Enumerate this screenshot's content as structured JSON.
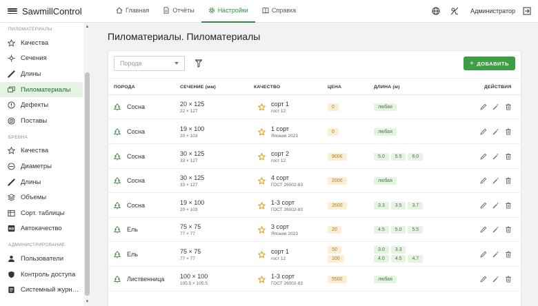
{
  "app": {
    "title": "SawmillControl"
  },
  "nav": [
    {
      "label": "Главная",
      "icon": "home-icon",
      "active": false
    },
    {
      "label": "Отчёты",
      "icon": "document-icon",
      "active": false
    },
    {
      "label": "Настройки",
      "icon": "gear-icon",
      "active": true
    },
    {
      "label": "Справка",
      "icon": "help-icon",
      "active": false
    }
  ],
  "topbar": {
    "user": "Администратор"
  },
  "sidebar": {
    "groups": [
      {
        "title": "ПИЛОМАТЕРИАЛЫ",
        "items": [
          {
            "label": "Качества",
            "icon": "star-icon",
            "active": false
          },
          {
            "label": "Сечения",
            "icon": "crosshair-icon",
            "active": false
          },
          {
            "label": "Длины",
            "icon": "ruler-icon",
            "active": false
          },
          {
            "label": "Пиломатериалы",
            "icon": "lumber-icon",
            "active": true
          },
          {
            "label": "Дефекты",
            "icon": "warning-icon",
            "active": false
          },
          {
            "label": "Поставы",
            "icon": "target-icon",
            "active": false
          }
        ]
      },
      {
        "title": "БРЕВНА",
        "items": [
          {
            "label": "Качества",
            "icon": "star-icon",
            "active": false
          },
          {
            "label": "Диаметры",
            "icon": "diameter-icon",
            "active": false
          },
          {
            "label": "Длины",
            "icon": "ruler-icon",
            "active": false
          },
          {
            "label": "Объемы",
            "icon": "layers-icon",
            "active": false
          },
          {
            "label": "Сорт. таблицы",
            "icon": "table-icon",
            "active": false
          },
          {
            "label": "Автокачество",
            "icon": "auto-icon",
            "active": false
          }
        ]
      },
      {
        "title": "АДМИНИСТРИРОВАНИЕ",
        "items": [
          {
            "label": "Пользователи",
            "icon": "users-icon",
            "active": false
          },
          {
            "label": "Контроль доступа",
            "icon": "shield-icon",
            "active": false
          },
          {
            "label": "Системный журн…",
            "icon": "log-icon",
            "active": false
          }
        ]
      }
    ]
  },
  "page": {
    "title": "Пиломатериалы. Пиломатериалы"
  },
  "toolbar": {
    "select_placeholder": "Порода",
    "add_label": "ДОБАВИТЬ"
  },
  "table": {
    "headers": {
      "poroda": "ПОРОДА",
      "sechenie": "СЕЧЕНИЕ (мм)",
      "kachestvo": "КАЧЕСТВО",
      "cena": "ЦЕНА",
      "dlina": "ДЛИНА (м)",
      "actions": "ДЕЙСТВИЯ"
    },
    "rows": [
      {
        "poroda": "Сосна",
        "sech": "20 × 125",
        "sech_sub": "22 × 127",
        "kach": "сорт 1",
        "kach_sub": "гост 12",
        "prices": [
          "0"
        ],
        "lengths": [
          [
            "любая"
          ]
        ]
      },
      {
        "poroda": "Сосна",
        "sech": "19 × 100",
        "sech_sub": "20 × 103",
        "kach": "1 сорт",
        "kach_sub": "Япония 2023",
        "prices": [
          "0"
        ],
        "lengths": [
          [
            "любая"
          ]
        ]
      },
      {
        "poroda": "Сосна",
        "sech": "30 × 125",
        "sech_sub": "33 × 127",
        "kach": "сорт 2",
        "kach_sub": "гост 12",
        "prices": [
          "9000"
        ],
        "lengths": [
          [
            "5.0",
            "5.5",
            "6.0"
          ]
        ]
      },
      {
        "poroda": "Сосна",
        "sech": "30 × 125",
        "sech_sub": "33 × 127",
        "kach": "4 сорт",
        "kach_sub": "ГОСТ 26002-83",
        "prices": [
          "2000"
        ],
        "lengths": [
          [
            "любая"
          ]
        ]
      },
      {
        "poroda": "Сосна",
        "sech": "19 × 100",
        "sech_sub": "20 × 103",
        "kach": "1-3 сорт",
        "kach_sub": "ГОСТ 26002-83",
        "prices": [
          "3500"
        ],
        "lengths": [
          [
            "3.3",
            "3.5",
            "3.7"
          ]
        ]
      },
      {
        "poroda": "Ель",
        "sech": "75 × 75",
        "sech_sub": "77 × 77",
        "kach": "3 сорт",
        "kach_sub": "Япония 2023",
        "prices": [
          "20"
        ],
        "lengths": [
          [
            "4.5",
            "5.0",
            "5.5"
          ]
        ]
      },
      {
        "poroda": "Ель",
        "sech": "75 × 75",
        "sech_sub": "77 × 77",
        "kach": "сорт 1",
        "kach_sub": "гост 12",
        "prices": [
          "50",
          "100"
        ],
        "lengths": [
          [
            "3.0",
            "3.3"
          ],
          [
            "4.0",
            "4.5",
            "4.7"
          ]
        ]
      },
      {
        "poroda": "Лиственница",
        "sech": "100 × 100",
        "sech_sub": "105.5 × 105.5",
        "kach": "1-3 сорт",
        "kach_sub": "ГОСТ 26002-83",
        "prices": [
          "5500"
        ],
        "lengths": [
          [
            "любая"
          ]
        ]
      }
    ]
  },
  "colors": {
    "accent": "#3f9d44",
    "active_bg": "#e6f2e3",
    "price_bg": "#fbeed7",
    "price_fg": "#b07a1d",
    "chip_bg": "#e6f3e2",
    "chip_fg": "#3d7d3a",
    "star": "#e2a21b"
  }
}
